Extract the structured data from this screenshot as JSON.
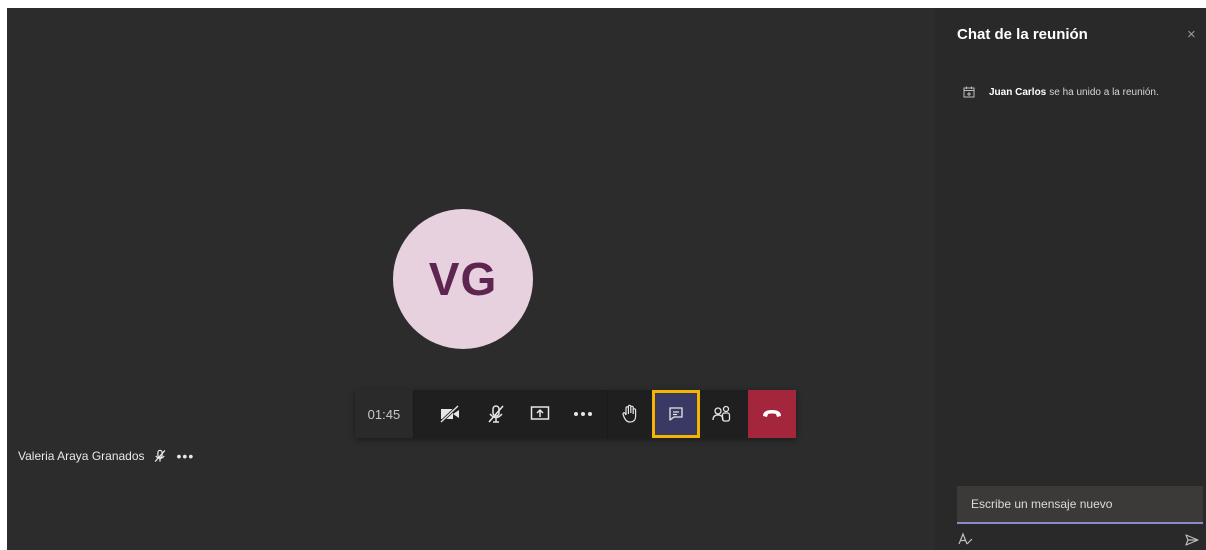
{
  "stage": {
    "avatar_initials": "VG",
    "avatar_bg": "#e8d1de",
    "avatar_fg": "#5e2550"
  },
  "toolbar": {
    "timer": "01:45",
    "buttons": [
      "camera-off-icon",
      "mic-off-icon",
      "share-screen-icon",
      "more-options-icon",
      "raise-hand-icon",
      "chat-icon",
      "participants-icon",
      "hang-up-icon"
    ],
    "leave_color": "#a4263c",
    "highlight_color": "#f4b400"
  },
  "participant": {
    "name": "Valeria Araya Granados",
    "more": "•••"
  },
  "chat": {
    "title": "Chat de la reunión",
    "close": "×",
    "event_name": "Juan Carlos",
    "event_text": "se ha unido a la reunión.",
    "compose_placeholder": "Escribe un mensaje nuevo"
  }
}
